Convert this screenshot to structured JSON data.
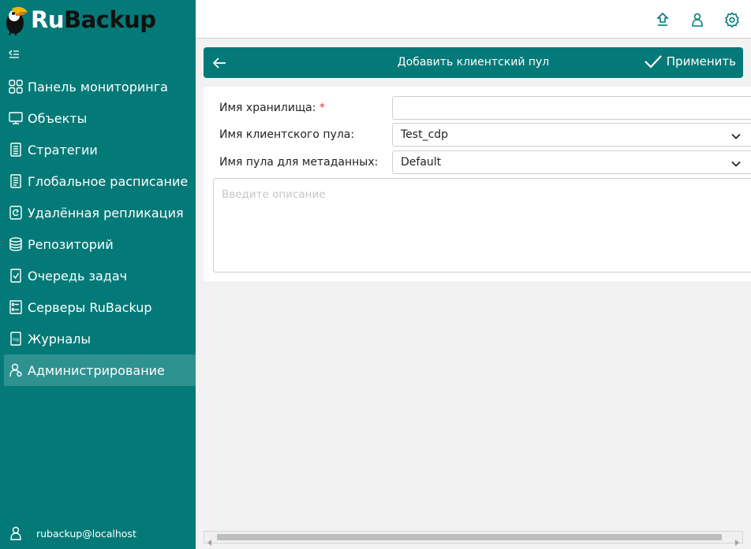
{
  "app": {
    "logo_ru": "Ru",
    "logo_backup": "Backup"
  },
  "sidebar": {
    "items": [
      {
        "label": "Панель мониторинга",
        "icon": "grid-icon"
      },
      {
        "label": "Объекты",
        "icon": "monitor-icon"
      },
      {
        "label": "Стратегии",
        "icon": "document-icon"
      },
      {
        "label": "Глобальное расписание",
        "icon": "list-document-icon"
      },
      {
        "label": "Удалённая репликация",
        "icon": "replication-icon"
      },
      {
        "label": "Репозиторий",
        "icon": "database-icon"
      },
      {
        "label": "Очередь задач",
        "icon": "checklist-icon"
      },
      {
        "label": "Серверы RuBackup",
        "icon": "server-icon"
      },
      {
        "label": "Журналы",
        "icon": "log-icon"
      },
      {
        "label": "Администрирование",
        "icon": "admin-user-icon",
        "active": true
      }
    ],
    "user": "rubackup@localhost"
  },
  "header": {
    "title": "Добавить клиентский пул",
    "apply_label": "Применить"
  },
  "form": {
    "storage_name_label": "Имя хранилища:",
    "required_mark": "*",
    "storage_name_value": "",
    "client_pool_label": "Имя клиентского пула:",
    "client_pool_value": "Test_cdp",
    "meta_pool_label": "Имя пула для метаданных:",
    "meta_pool_value": "Default",
    "description_placeholder": "Введите описание"
  },
  "colors": {
    "brand": "#047a78",
    "active_item": "#2e9290",
    "required": "#d9342b"
  }
}
